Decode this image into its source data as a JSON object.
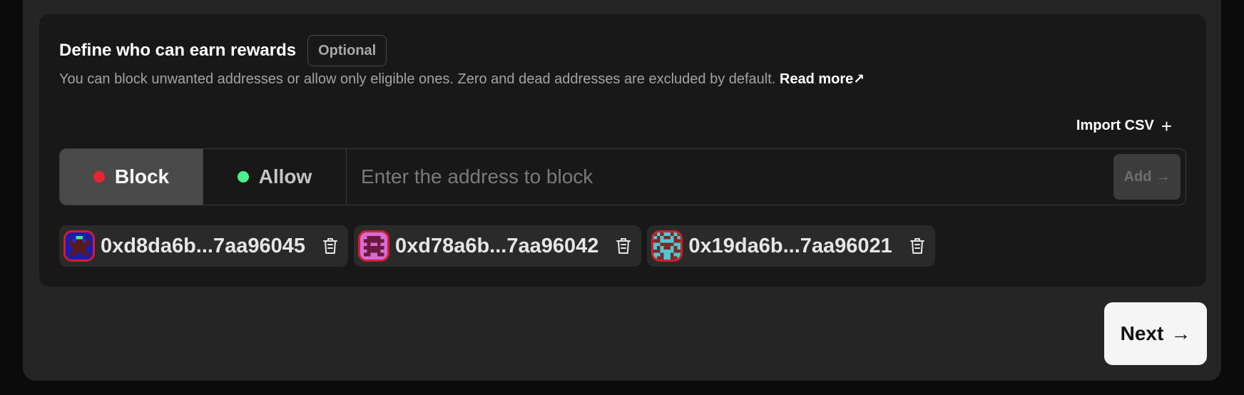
{
  "section": {
    "title": "Define who can earn rewards",
    "badge": "Optional",
    "description": "You can block unwanted addresses or allow only eligible ones. Zero and dead addresses are excluded by default.",
    "read_more": "Read more",
    "read_more_icon": "↗"
  },
  "import": {
    "label": "Import CSV",
    "icon": "+"
  },
  "mode": {
    "selected": "Block",
    "options": [
      {
        "label": "Block",
        "color": "#e5252f"
      },
      {
        "label": "Allow",
        "color": "#4cf08a"
      }
    ]
  },
  "address_input": {
    "placeholder": "Enter the address to block",
    "value": ""
  },
  "add_button": {
    "label": "Add",
    "icon": "→"
  },
  "addresses": [
    {
      "short": "0xd8da6b...7aa96045",
      "avatar_icon": "pixel-avatar-blue"
    },
    {
      "short": "0xd78a6b...7aa96042",
      "avatar_icon": "pixel-avatar-magenta"
    },
    {
      "short": "0x19da6b...7aa96021",
      "avatar_icon": "pixel-avatar-cyan"
    }
  ],
  "next_button": {
    "label": "Next",
    "icon": "→"
  },
  "colors": {
    "page_bg": "#0b0b0b",
    "panel_bg": "#252525",
    "card_bg": "#181818",
    "accent_red": "#e5252f",
    "accent_green": "#4cf08a"
  }
}
